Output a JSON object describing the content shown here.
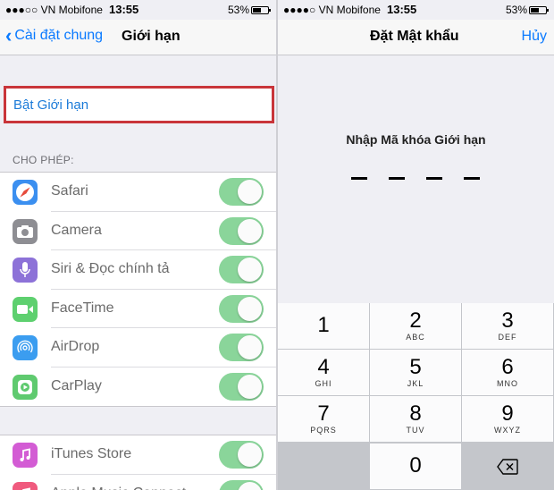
{
  "left": {
    "status": {
      "carrier": "●●●○○ VN Mobifone",
      "time": "13:55",
      "battery": "53%"
    },
    "nav": {
      "back_label": "Cài đặt chung",
      "title": "Giới hạn"
    },
    "enable_label": "Bật Giới hạn",
    "allow_header": "CHO PHÉP:",
    "apps": [
      {
        "label": "Safari",
        "icon": "safari-icon",
        "on": true
      },
      {
        "label": "Camera",
        "icon": "camera-icon",
        "on": true
      },
      {
        "label": "Siri & Đọc chính tả",
        "icon": "microphone-icon",
        "on": true
      },
      {
        "label": "FaceTime",
        "icon": "facetime-icon",
        "on": true
      },
      {
        "label": "AirDrop",
        "icon": "airdrop-icon",
        "on": true
      },
      {
        "label": "CarPlay",
        "icon": "carplay-icon",
        "on": true
      }
    ],
    "apps2": [
      {
        "label": "iTunes Store",
        "icon": "itunes-icon",
        "on": true
      },
      {
        "label": "Apple Music Connect",
        "icon": "music-icon",
        "on": true
      }
    ]
  },
  "right": {
    "status": {
      "carrier": "●●●●○ VN Mobifone",
      "time": "13:55",
      "battery": "53%"
    },
    "nav": {
      "title": "Đặt Mật khẩu",
      "cancel_label": "Hủy"
    },
    "prompt": "Nhập Mã khóa Giới hạn",
    "keys": [
      {
        "num": "1",
        "letters": ""
      },
      {
        "num": "2",
        "letters": "ABC"
      },
      {
        "num": "3",
        "letters": "DEF"
      },
      {
        "num": "4",
        "letters": "GHI"
      },
      {
        "num": "5",
        "letters": "JKL"
      },
      {
        "num": "6",
        "letters": "MNO"
      },
      {
        "num": "7",
        "letters": "PQRS"
      },
      {
        "num": "8",
        "letters": "TUV"
      },
      {
        "num": "9",
        "letters": "WXYZ"
      },
      {
        "num": "0",
        "letters": ""
      }
    ]
  },
  "colors": {
    "accent": "#0a7aff",
    "toggle_on": "#8ad59a",
    "highlight_border": "#c9353a"
  }
}
